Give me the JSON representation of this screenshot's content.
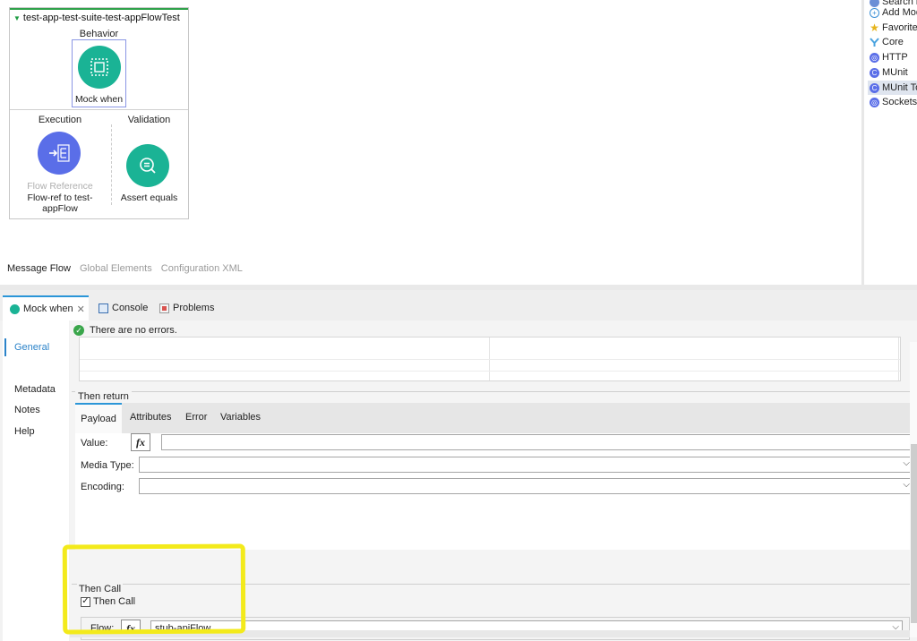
{
  "canvas": {
    "suite_title": "test-app-test-suite-test-appFlowTest",
    "behavior_label": "Behavior",
    "mock_label": "Mock when",
    "execution_label": "Execution",
    "validation_label": "Validation",
    "flow_ref_type": "Flow Reference",
    "flow_ref_name": "Flow-ref to test-appFlow",
    "assert_label": "Assert equals",
    "tabs": {
      "message_flow": "Message Flow",
      "global_elements": "Global Elements",
      "configuration_xml": "Configuration XML"
    }
  },
  "palette": {
    "items": [
      {
        "label": "Search in",
        "icon": "search-icon"
      },
      {
        "label": "Add Mod",
        "icon": "add-icon"
      },
      {
        "label": "Favorites",
        "icon": "star-icon"
      },
      {
        "label": "Core",
        "icon": "core-icon"
      },
      {
        "label": "HTTP",
        "icon": "module-icon"
      },
      {
        "label": "MUnit",
        "icon": "module-icon"
      },
      {
        "label": "MUnit To",
        "icon": "module-icon"
      },
      {
        "label": "Sockets",
        "icon": "module-icon"
      }
    ],
    "selected_index": 6
  },
  "bottom_tabs": {
    "mock_when": "Mock when",
    "console": "Console",
    "problems": "Problems"
  },
  "nav": {
    "general": "General",
    "metadata": "Metadata",
    "notes": "Notes",
    "help": "Help"
  },
  "status": {
    "message": "There are no errors."
  },
  "then_return": {
    "title": "Then return",
    "tabs": {
      "payload": "Payload",
      "attributes": "Attributes",
      "error": "Error",
      "variables": "Variables"
    },
    "value_label": "Value:",
    "media_type_label": "Media Type:",
    "encoding_label": "Encoding:",
    "fx": "fx"
  },
  "then_call": {
    "title": "Then Call",
    "checkbox_label": "Then Call",
    "checked": true,
    "flow_label": "Flow:",
    "flow_value": "stub-apiFlow"
  },
  "colors": {
    "accent_blue": "#2b96d8",
    "teal": "#1ab395",
    "purple": "#5a6ee8",
    "highlight_yellow": "#f3ea1b"
  }
}
